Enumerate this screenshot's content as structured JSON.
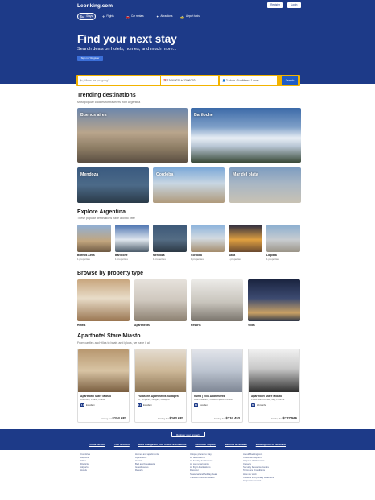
{
  "header": {
    "logo": "Leonking.com",
    "register": "Register",
    "login": "Login",
    "nav": [
      {
        "icon": "bed-icon",
        "label": "Stays"
      },
      {
        "icon": "plane-icon",
        "label": "Flights"
      },
      {
        "icon": "car-icon",
        "label": "Car rentals"
      },
      {
        "icon": "attraction-icon",
        "label": "Attractions"
      },
      {
        "icon": "taxi-icon",
        "label": "Airport taxis"
      }
    ],
    "title": "Find your next stay",
    "subtitle": "Search deals on hotels, homes, and much more...",
    "signin": "Sign in / Register"
  },
  "search": {
    "destination_placeholder": "Where are you going?",
    "dates": "13/06/2024 to 13/06/2024",
    "guests": "2 adults · 0 children · 1 room",
    "button": "Search"
  },
  "trending": {
    "title": "Trending destinations",
    "subtitle": "Most popular choices for travelers from Argentina",
    "items": [
      "Buenos aires",
      "Bariloche",
      "Mendoza",
      "Cordoba",
      "Mar del plata"
    ]
  },
  "explore": {
    "title": "Explore Argentina",
    "subtitle": "These popular destinations have a lot to offer",
    "items": [
      {
        "name": "Buenos Aires",
        "count": "1 properties"
      },
      {
        "name": "Bariloche",
        "count": "1 properties"
      },
      {
        "name": "Mendoza",
        "count": "1 properties"
      },
      {
        "name": "Cordoba",
        "count": "1 properties"
      },
      {
        "name": "Salta",
        "count": "1 properties"
      },
      {
        "name": "La plata",
        "count": "1 properties"
      }
    ]
  },
  "property_types": {
    "title": "Browse by property type",
    "items": [
      "Hotels",
      "Apartments",
      "Resorts",
      "Villas"
    ]
  },
  "featured": {
    "title": "Aparthotel Stare Miasto",
    "subtitle": "From castles and villas to boats and igloos, we have it all",
    "cards": [
      {
        "name": "Aparthotel Stare Miasto",
        "address": "Los Cisne, Poland, Krakow",
        "score": "8.9",
        "rating": "Excellent",
        "from": "Starting from",
        "price": "$154.687"
      },
      {
        "name": "7Seasons Apartments Budapest",
        "address": "45, Yomjanlos, Hungary, Budapest",
        "score": "8.8",
        "rating": "Excellent",
        "from": "Starting from",
        "price": "$163.687"
      },
      {
        "name": "numa | Villa Apartments",
        "address": "Beach Gardens, United Kingdom, London",
        "score": "8.9",
        "rating": "Excellent",
        "from": "Starting from",
        "price": "$234.453"
      },
      {
        "name": "Aparthotel Stare Miasto",
        "address": "Paseo Maria Dorado, Italy, Florence",
        "score": "8.9",
        "rating": "Wonderful",
        "from": "Starting from",
        "price": "$327.566"
      }
    ]
  },
  "footer": {
    "register": "Register your property",
    "links": [
      "Phone version",
      "Your account",
      "Make changes to your online reservations",
      "Customer Support",
      "Become an affiliate",
      "Booking.com for Business"
    ],
    "col1": [
      "Countries",
      "Regions",
      "Cities",
      "Districts",
      "Airports",
      "Hotels"
    ],
    "col2": [
      "Homes and apartments",
      "Apartments",
      "Hostels",
      "Bed and breakfasts",
      "Guesthouses",
      "Resorts"
    ],
    "col3": [
      "Unique places to stay",
      "All destinations",
      "All holiday destinations",
      "All car rental points",
      "All flight destinations",
      "Discover",
      "Seasonal and holiday deals",
      "Traveller Review awards"
    ],
    "col4": [
      "About Booking.com",
      "Customer Support",
      "Help for collaborators",
      "Careers",
      "Security Resource Centre",
      "Terms and Conditions",
      "How we work",
      "Cookies and privacy statement",
      "Corporate contact"
    ]
  }
}
